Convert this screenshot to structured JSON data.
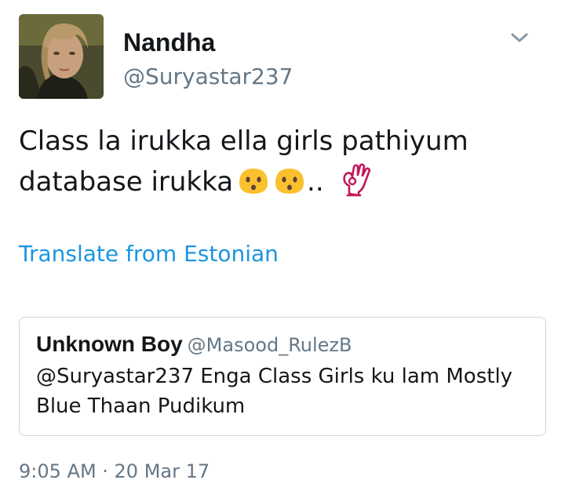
{
  "author": {
    "display_name": "Nandha",
    "handle": "@Suryastar237",
    "avatar_icon": "profile-photo"
  },
  "menu": {
    "icon": "chevron-down-icon"
  },
  "tweet": {
    "text_line1": "Class la irukka ella girls pathiyum",
    "text_line2_prefix": "database irukka",
    "text_line2_suffix": "..",
    "emojis": [
      "hushed-face-icon",
      "hushed-face-icon",
      "ok-hand-icon"
    ]
  },
  "translate": {
    "label": "Translate from Estonian"
  },
  "quoted_tweet": {
    "display_name": "Unknown Boy",
    "handle": "@Masood_RulezB",
    "text": "@Suryastar237 Enga Class Girls ku lam Mostly Blue Thaan Pudikum"
  },
  "timestamp": "9:05 AM · 20 Mar 17",
  "colors": {
    "link": "#1b95e0",
    "secondary_text": "#657786",
    "primary_text": "#14171a",
    "border": "#ccd6dd"
  }
}
